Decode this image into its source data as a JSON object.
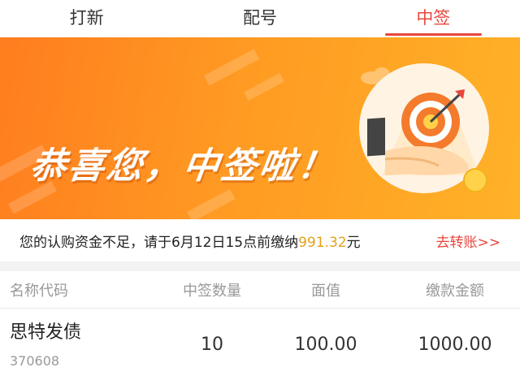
{
  "tabs": [
    {
      "label": "打新"
    },
    {
      "label": "配号"
    },
    {
      "label": "中签"
    }
  ],
  "active_tab": "中签",
  "banner": {
    "title": "恭喜您，中签啦！",
    "coin_symbol": "¥"
  },
  "notice": {
    "prefix": "您的认购资金不足，请于6月12日15点前缴纳",
    "amount": "991.32",
    "suffix": "元",
    "link": "去转账>>"
  },
  "table": {
    "headers": [
      "名称代码",
      "中签数量",
      "面值",
      "缴款金额"
    ],
    "rows": [
      {
        "name": "思特发债",
        "code": "370608",
        "quantity": "10",
        "face_value": "100.00",
        "payment": "1000.00"
      }
    ]
  },
  "colors": {
    "accent": "#e8463d",
    "banner_orange": "#ff9a22",
    "amount": "#e3a11c"
  }
}
